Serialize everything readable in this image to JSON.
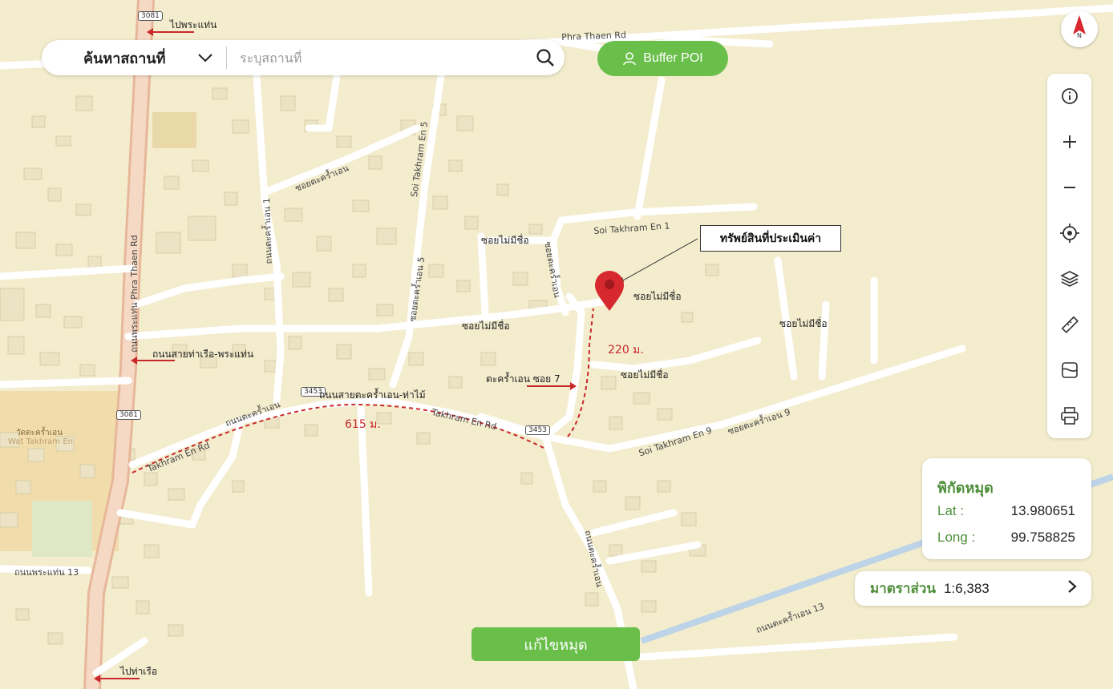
{
  "search": {
    "type_label": "ค้นหาสถานที่",
    "placeholder": "ระบุสถานที่"
  },
  "buffer_button": {
    "label": "Buffer POI"
  },
  "compass": {
    "label": "N"
  },
  "toolbar": {
    "icons": [
      "info-icon",
      "zoom-in-icon",
      "zoom-out-icon",
      "locate-icon",
      "layers-icon",
      "ruler-icon",
      "map-export-icon",
      "print-icon"
    ]
  },
  "coordinates_panel": {
    "title": "พิกัดหมุด",
    "lat_label": "Lat :",
    "lat_value": "13.980651",
    "long_label": "Long :",
    "long_value": "99.758825"
  },
  "scale_panel": {
    "label": "มาตราส่วน",
    "value": "1:6,383"
  },
  "edit_pin_button": {
    "label": "แก้ไขหมุด"
  },
  "annotation": {
    "label": "ทรัพย์สินที่ประเมินค่า"
  },
  "distances": {
    "main_road": "615 ม.",
    "soi": "220 ม."
  },
  "map_labels": {
    "to_phra_thaen": "ไปพระแท่น",
    "to_tha_ruea": "ไปท่าเรือ",
    "road_tha_ruea_phra_thaen": "ถนนสายท่าเรือ-พระแท่น",
    "road_takhram_en_tha_mai": "ถนนสายตะคร้ำเอน-ท่าไม้",
    "takhram_soi7": "ตะคร้ำเอน ซอย 7",
    "soi_no_name": "ซอยไม่มีชื่อ",
    "phra_thaen_rd": "ถนนพระแท่น Phra Thaen Rd",
    "phra_thaen_rd_top": "Phra Thaen Rd",
    "takhram_en_rd": "Takhram En Rd",
    "takhram_en_rd_th": "ถนนตะคร้ำเอน",
    "soi_takhram_en_1": "Soi Takhram En 1",
    "soi_takhram_en_5": "Soi Takhram En 5",
    "soi_takhram_en_9": "Soi Takhram En 9",
    "takhram_en_5_th": "ซอยตะคร้ำเอน 5",
    "takhram_en_1_th": "ถนนตะคร้ำเอน 1",
    "takhram_en_9_th": "ซอยตะคร้ำเอน 9",
    "takhram_en_13_th": "ถนนตะคร้ำเอน 13",
    "phra_thaen_13_th": "ถนนพระแท่น 13",
    "soi_top_th": "ซอยตะคร้ำเอน",
    "wat_th": "วัดตะคร้ำเอน",
    "wat_en": "Wat Takhram En",
    "kw_road_th": "ถนนตะคร้ำเอน",
    "rt3081_a": "3081",
    "rt3081_b": "3081",
    "rt3453_a": "3453",
    "rt3453_b": "3453"
  }
}
